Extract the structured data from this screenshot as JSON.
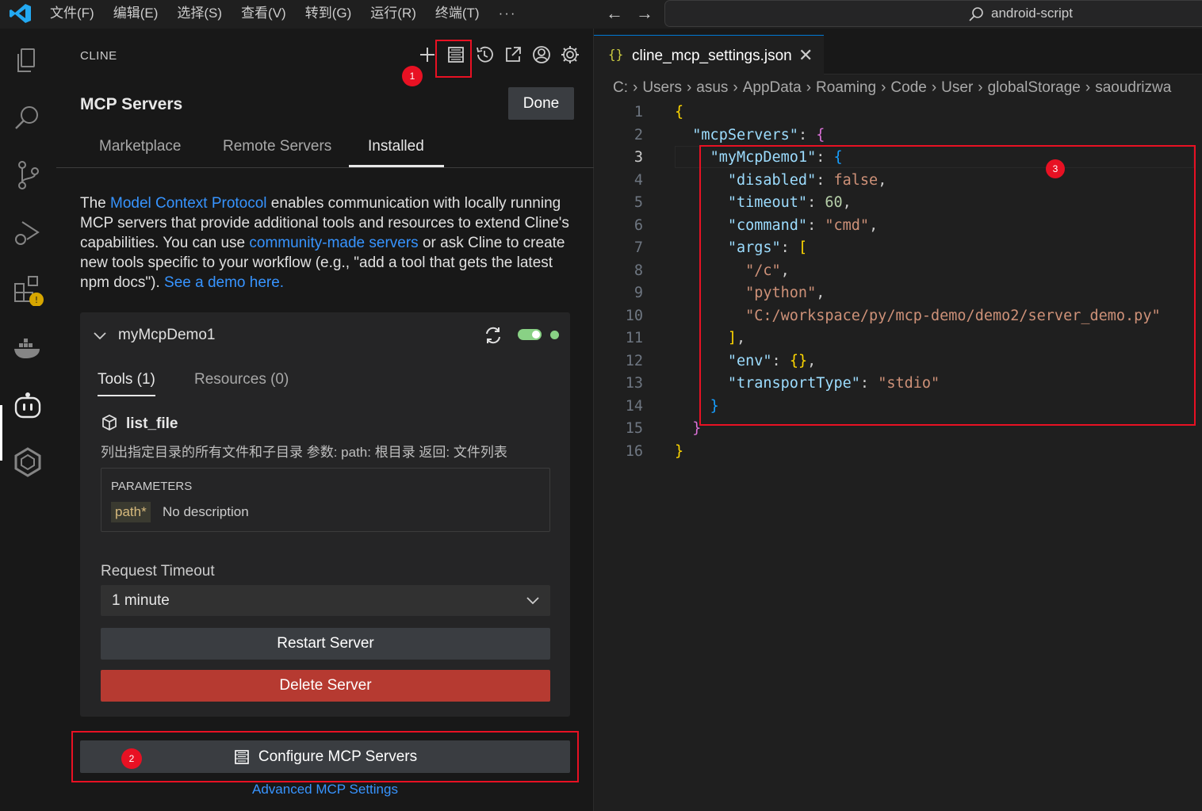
{
  "titlebar": {
    "menu": [
      "文件(F)",
      "编辑(E)",
      "选择(S)",
      "查看(V)",
      "转到(G)",
      "运行(R)",
      "终端(T)",
      "···"
    ],
    "search_text": "android-script"
  },
  "activitybar": {
    "items": [
      "explorer-icon",
      "search-icon",
      "source-control-icon",
      "run-debug-icon",
      "extensions-icon",
      "docker-icon",
      "cline-icon",
      "hexagon-icon"
    ],
    "warning_badge": "⚠"
  },
  "sidebar": {
    "title": "CLINE",
    "header_title": "MCP Servers",
    "done_label": "Done",
    "tabs": [
      "Marketplace",
      "Remote Servers",
      "Installed"
    ],
    "intro": {
      "t1": "The ",
      "link1": "Model Context Protocol",
      "t2": " enables communication with locally running MCP servers that provide additional tools and resources to extend Cline's capabilities. You can use ",
      "link2": "community-made servers",
      "t3": " or ask Cline to create new tools specific to your workflow (e.g., \"add a tool that gets the latest npm docs\"). ",
      "link3": "See a demo here."
    },
    "server": {
      "name": "myMcpDemo1",
      "tabs": [
        "Tools (1)",
        "Resources (0)"
      ],
      "tool_name": "list_file",
      "tool_desc": "列出指定目录的所有文件和子目录 参数: path: 根目录 返回: 文件列表",
      "params_header": "PARAMETERS",
      "param_name": "path*",
      "param_desc": "No description",
      "timeout_label": "Request Timeout",
      "timeout_value": "1 minute",
      "restart_label": "Restart Server",
      "delete_label": "Delete Server"
    },
    "configure_label": "Configure MCP Servers",
    "advanced_link": "Advanced MCP Settings",
    "badges": [
      "1",
      "2",
      "3"
    ]
  },
  "editor": {
    "tab_label": "cline_mcp_settings.json",
    "tab_icon": "{}",
    "breadcrumbs": [
      "C:",
      "Users",
      "asus",
      "AppData",
      "Roaming",
      "Code",
      "User",
      "globalStorage",
      "saoudrizwa"
    ],
    "line_numbers": [
      "1",
      "2",
      "3",
      "4",
      "5",
      "6",
      "7",
      "8",
      "9",
      "10",
      "11",
      "12",
      "13",
      "14",
      "15",
      "16"
    ],
    "code": {
      "mcpServers": "\"mcpServers\"",
      "myMcpDemo1": "\"myMcpDemo1\"",
      "disabled_key": "\"disabled\"",
      "disabled_val": "false",
      "timeout_key": "\"timeout\"",
      "timeout_val": "60",
      "command_key": "\"command\"",
      "command_val": "\"cmd\"",
      "args_key": "\"args\"",
      "arg1": "\"/c\"",
      "arg2": "\"python\"",
      "arg3": "\"C:/workspace/py/mcp-demo/demo2/server_demo.py\"",
      "env_key": "\"env\"",
      "transport_key": "\"transportType\"",
      "transport_val": "\"stdio\""
    }
  },
  "colors": {
    "highlight": "#e81123",
    "accent_link": "#3794ff",
    "delete": "#b63a31",
    "status_on": "#89d185"
  }
}
